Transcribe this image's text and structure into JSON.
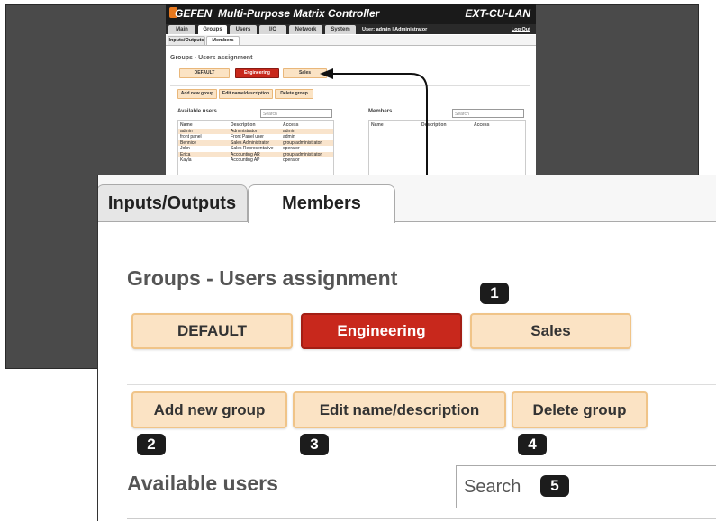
{
  "app": {
    "brand": "GEFEN",
    "product": "Multi-Purpose Matrix Controller",
    "model": "EXT-CU-LAN"
  },
  "nav": {
    "tabs": [
      "Main",
      "Groups",
      "Users",
      "I/O",
      "Network",
      "System"
    ],
    "user_info": "User: admin  |  Administrator",
    "logout": "Log Out"
  },
  "subtabs": [
    "Inputs/Outputs",
    "Members"
  ],
  "section_title": "Groups - Users assignment",
  "groups": [
    "DEFAULT",
    "Engineering",
    "Sales"
  ],
  "actions": {
    "add": "Add new group",
    "edit": "Edit name/description",
    "delete": "Delete group"
  },
  "available_users": {
    "label": "Available users",
    "search_placeholder": "Search",
    "columns": [
      "Name",
      "Description",
      "Access"
    ],
    "rows": [
      [
        "admin",
        "Administrator",
        "admin"
      ],
      [
        "front panel",
        "Front Panel user",
        "admin"
      ],
      [
        "Bennice",
        "Sales Administrator",
        "group administrator"
      ],
      [
        "John",
        "Sales Representative",
        "operator"
      ],
      [
        "Erica",
        "Accounting AR",
        "group administrator"
      ],
      [
        "Kayla",
        "Accounting AP",
        "operator"
      ]
    ]
  },
  "members": {
    "label": "Members",
    "search_placeholder": "Search",
    "columns": [
      "Name",
      "Description",
      "Access"
    ]
  },
  "callouts": [
    "1",
    "2",
    "3",
    "4",
    "5"
  ],
  "colors": {
    "active_group": "#c8281c",
    "button_bg": "#fbe3c4",
    "background_panel": "#4a4a4a",
    "brand_accent": "#e8791f"
  },
  "icons": [
    "arrow-icon"
  ]
}
